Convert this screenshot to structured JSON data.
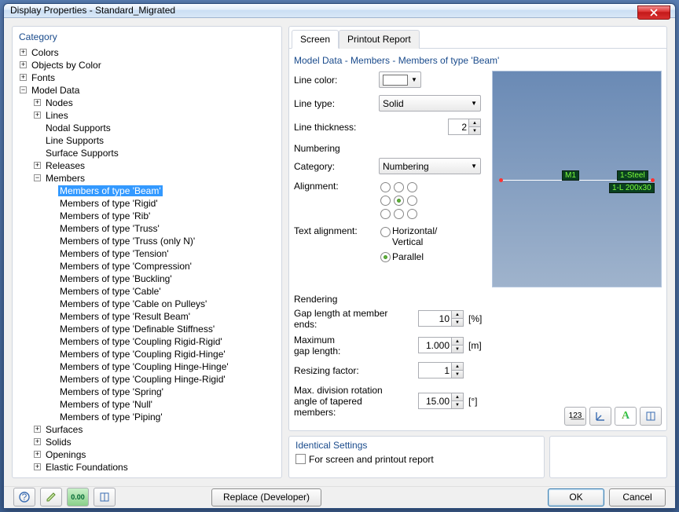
{
  "title": "Display Properties - Standard_Migrated",
  "left_panel_title": "Category",
  "tree": [
    {
      "label": "Colors",
      "exp": "+"
    },
    {
      "label": "Objects by Color",
      "exp": "+"
    },
    {
      "label": "Fonts",
      "exp": "+"
    },
    {
      "label": "Model Data",
      "exp": "-",
      "children": [
        {
          "label": "Nodes",
          "exp": "+"
        },
        {
          "label": "Lines",
          "exp": "+"
        },
        {
          "label": "Nodal Supports",
          "exp": ""
        },
        {
          "label": "Line Supports",
          "exp": ""
        },
        {
          "label": "Surface Supports",
          "exp": ""
        },
        {
          "label": "Releases",
          "exp": "+"
        },
        {
          "label": "Members",
          "exp": "-",
          "children": [
            {
              "label": "Members of type 'Beam'",
              "selected": true
            },
            {
              "label": "Members of type 'Rigid'"
            },
            {
              "label": "Members of type 'Rib'"
            },
            {
              "label": "Members of type 'Truss'"
            },
            {
              "label": "Members of type 'Truss (only N)'"
            },
            {
              "label": "Members of type 'Tension'"
            },
            {
              "label": "Members of type 'Compression'"
            },
            {
              "label": "Members of type 'Buckling'"
            },
            {
              "label": "Members of type 'Cable'"
            },
            {
              "label": "Members of type 'Cable on Pulleys'"
            },
            {
              "label": "Members of type 'Result Beam'"
            },
            {
              "label": "Members of type 'Definable Stiffness'"
            },
            {
              "label": "Members of type 'Coupling Rigid-Rigid'"
            },
            {
              "label": "Members of type 'Coupling Rigid-Hinge'"
            },
            {
              "label": "Members of type 'Coupling Hinge-Hinge'"
            },
            {
              "label": "Members of type 'Coupling Hinge-Rigid'"
            },
            {
              "label": "Members of type 'Spring'"
            },
            {
              "label": "Members of type 'Null'"
            },
            {
              "label": "Members of type 'Piping'"
            }
          ]
        },
        {
          "label": "Surfaces",
          "exp": "+"
        },
        {
          "label": "Solids",
          "exp": "+"
        },
        {
          "label": "Openings",
          "exp": "+"
        },
        {
          "label": "Elastic Foundations",
          "exp": "+"
        }
      ]
    }
  ],
  "tabs": {
    "screen": "Screen",
    "printout": "Printout Report"
  },
  "section_title": "Model Data - Members - Members of type 'Beam'",
  "form": {
    "line_color_label": "Line color:",
    "line_type_label": "Line type:",
    "line_type_value": "Solid",
    "line_thickness_label": "Line thickness:",
    "line_thickness_value": "2",
    "numbering_head": "Numbering",
    "category_label": "Category:",
    "category_value": "Numbering",
    "alignment_label": "Alignment:",
    "text_align_label": "Text alignment:",
    "text_align_opt1": "Horizontal/\nVertical",
    "text_align_opt2": "Parallel",
    "rendering_head": "Rendering",
    "gap_length_label": "Gap length at member ends:",
    "gap_length_value": "10",
    "gap_length_unit": "[%]",
    "max_gap_label": "Maximum\ngap length:",
    "max_gap_value": "1.000",
    "max_gap_unit": "[m]",
    "resize_label": "Resizing factor:",
    "resize_value": "1",
    "max_div_label": "Max. division rotation angle of tapered members:",
    "max_div_value": "15.00",
    "max_div_unit": "[°]"
  },
  "preview": {
    "badge1": "M1",
    "badge2": "1-Steel",
    "badge3": "1-L 200x30"
  },
  "identical": {
    "title": "Identical Settings",
    "checkbox_label": "For screen and printout report"
  },
  "footer": {
    "replace": "Replace (Developer)",
    "ok": "OK",
    "cancel": "Cancel"
  }
}
